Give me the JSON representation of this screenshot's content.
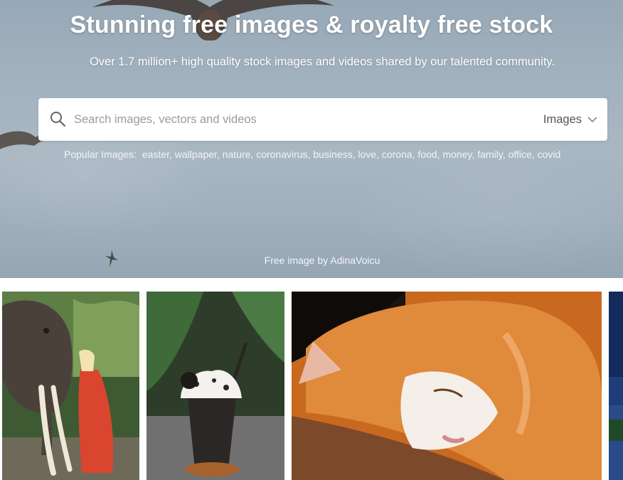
{
  "hero": {
    "title": "Stunning free images & royalty free stock",
    "subtitle": "Over 1.7 million+ high quality stock images and videos shared by our talented community.",
    "credit_prefix": "Free image by",
    "credit_author": "AdinaVoicu"
  },
  "search": {
    "placeholder": "Search images, vectors and videos",
    "type_selected": "Images",
    "icon": "search-icon",
    "dropdown_icon": "chevron-down-icon"
  },
  "popular": {
    "label": "Popular Images:",
    "tags": [
      "easter",
      "wallpaper",
      "nature",
      "coronavirus",
      "business",
      "love",
      "corona",
      "food",
      "money",
      "family",
      "office",
      "covid"
    ]
  },
  "gallery": [
    {
      "subject": "woman-with-elephant"
    },
    {
      "subject": "iced-chocolate-drink"
    },
    {
      "subject": "sleeping-orange-cat"
    },
    {
      "subject": "night-sky"
    }
  ],
  "colors": {
    "hero_sky": "#a3b2bf",
    "text_on_hero": "#ffffff",
    "search_text": "#555555",
    "placeholder": "#9b9b9b"
  }
}
